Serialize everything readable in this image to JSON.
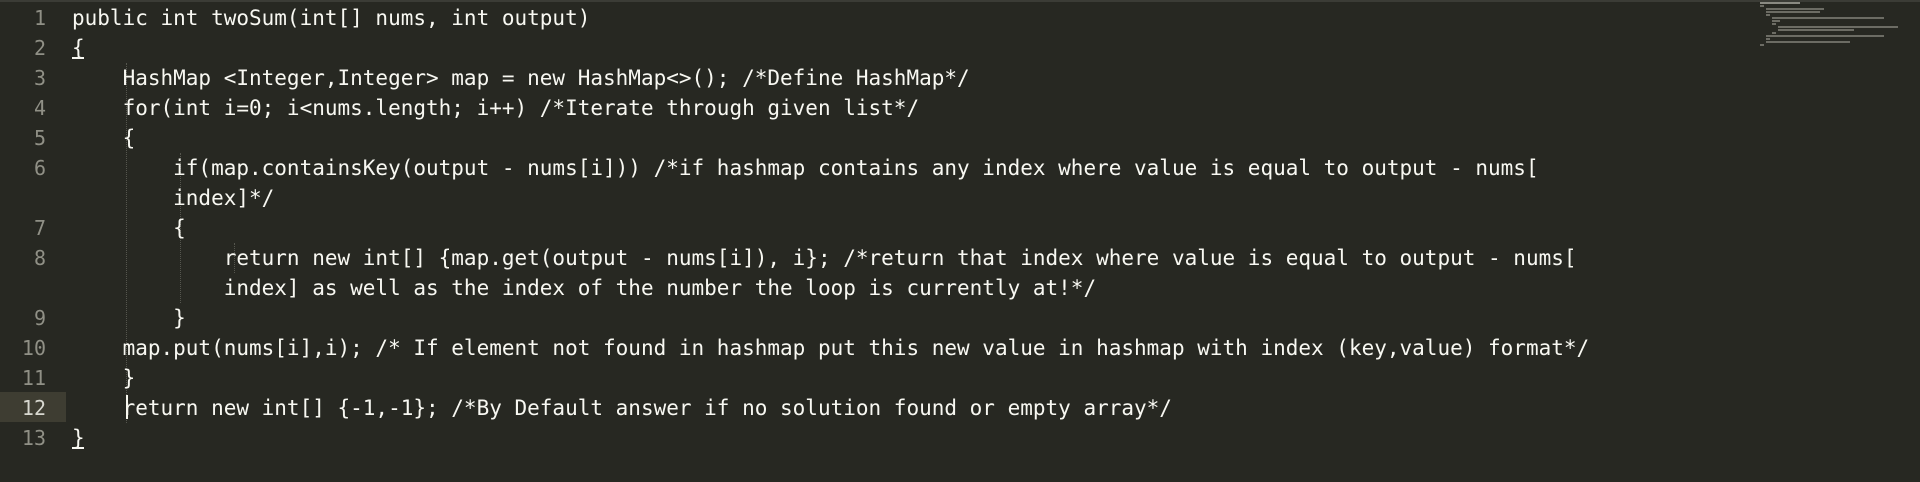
{
  "editor": {
    "current_line": 12,
    "lines": [
      {
        "num": "1",
        "text": "public int twoSum(int[] nums, int output)"
      },
      {
        "num": "2",
        "text": "{"
      },
      {
        "num": "3",
        "text": "    HashMap <Integer,Integer> map = new HashMap<>(); /*Define HashMap*/"
      },
      {
        "num": "4",
        "text": "    for(int i=0; i<nums.length; i++) /*Iterate through given list*/"
      },
      {
        "num": "5",
        "text": "    {"
      },
      {
        "num": "6",
        "text": "        if(map.containsKey(output - nums[i])) /*if hashmap contains any index where value is equal to output - nums["
      },
      {
        "num": "",
        "text": "        index]*/"
      },
      {
        "num": "7",
        "text": "        {"
      },
      {
        "num": "8",
        "text": "            return new int[] {map.get(output - nums[i]), i}; /*return that index where value is equal to output - nums["
      },
      {
        "num": "",
        "text": "            index] as well as the index of the number the loop is currently at!*/"
      },
      {
        "num": "9",
        "text": "        }"
      },
      {
        "num": "10",
        "text": "    map.put(nums[i],i); /* If element not found in hashmap put this new value in hashmap with index (key,value) format*/"
      },
      {
        "num": "11",
        "text": "    }"
      },
      {
        "num": "12",
        "text": "    return new int[] {-1,-1}; /*By Default answer if no solution found or empty array*/"
      },
      {
        "num": "13",
        "text": "}"
      }
    ]
  },
  "colors": {
    "background": "#272822",
    "text": "#f8f8f2",
    "gutter_text": "#909086",
    "current_line": "#3e3d32"
  }
}
